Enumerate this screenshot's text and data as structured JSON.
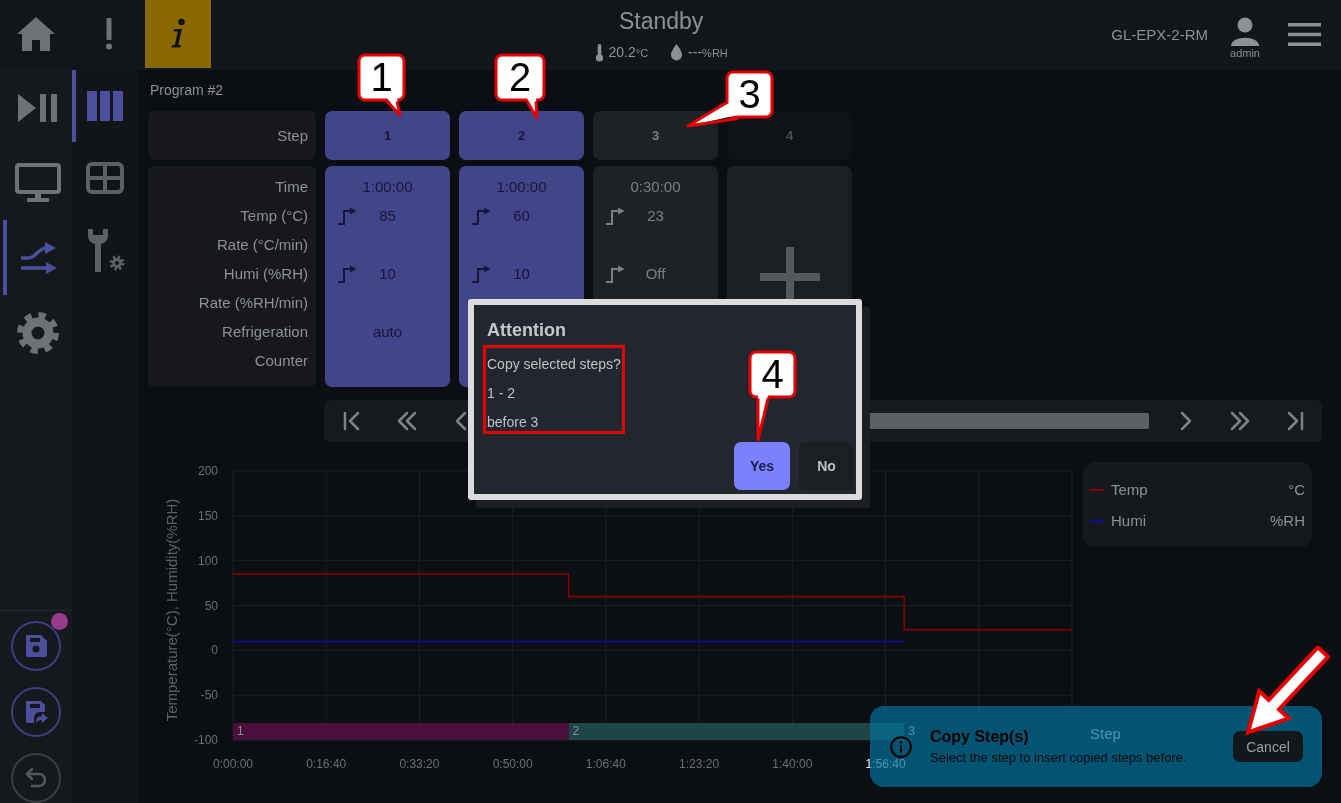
{
  "top_bar": {
    "buttons": [
      {
        "kind": "home",
        "highlighted": false
      },
      {
        "kind": "alert",
        "highlighted": false
      },
      {
        "kind": "info",
        "highlighted": true
      }
    ],
    "status": "Standby",
    "temperature": {
      "value": "20.2",
      "unit": "°C"
    },
    "humidity": {
      "value": "---",
      "unit": "%RH"
    },
    "device": "GL-EPX-2-RM",
    "user": "admin"
  },
  "nav_rail": [
    {
      "kind": "run",
      "selected": false
    },
    {
      "kind": "monitor",
      "selected": false
    },
    {
      "kind": "program",
      "selected": true
    },
    {
      "kind": "settings",
      "selected": false
    }
  ],
  "sub_rail": [
    {
      "kind": "columns",
      "selected": true
    },
    {
      "kind": "table",
      "selected": false
    },
    {
      "kind": "tools",
      "selected": false
    }
  ],
  "file_actions": [
    {
      "kind": "save",
      "badge": true,
      "disabled": false
    },
    {
      "kind": "save_as",
      "badge": false,
      "disabled": false
    },
    {
      "kind": "undo",
      "badge": false,
      "disabled": true
    }
  ],
  "program": {
    "title": "Program #2",
    "step_label": "Step",
    "field_labels": [
      "Time",
      "Temp (°C)",
      "Rate (°C/min)",
      "Humi (%RH)",
      "Rate (%RH/min)",
      "Refrigeration",
      "Counter"
    ],
    "steps": [
      {
        "kind": "step",
        "number": "1",
        "selected": true,
        "time": "1:00:00",
        "temp": "85",
        "humi": "10",
        "refrigeration": "auto"
      },
      {
        "kind": "step",
        "number": "2",
        "selected": true,
        "time": "1:00:00",
        "temp": "60",
        "humi": "10"
      },
      {
        "kind": "step",
        "number": "3",
        "selected": false,
        "time": "0:30:00",
        "temp": "23",
        "humi": "Off"
      },
      {
        "kind": "add",
        "number": "4"
      }
    ]
  },
  "pager": {
    "left": [
      {
        "kind": "first"
      },
      {
        "kind": "rewind"
      },
      {
        "kind": "back"
      }
    ],
    "right": [
      {
        "kind": "forward"
      },
      {
        "kind": "fast_forward"
      },
      {
        "kind": "last"
      }
    ]
  },
  "chart": {
    "chart_data": {
      "type": "line",
      "ylabel": "Temperature(°C), Humidity(%RH)",
      "x": [
        0,
        3600,
        3600,
        7200,
        7200,
        9000
      ],
      "series": [
        {
          "name": "Temp",
          "color": "#8b0000",
          "values": [
            85,
            85,
            60,
            60,
            23,
            23
          ]
        },
        {
          "name": "Humi",
          "color": "#0c0c9c",
          "values": [
            10,
            10,
            10,
            10,
            null,
            null
          ]
        }
      ],
      "xlim": [
        0,
        9000
      ],
      "ylim": [
        -100,
        200
      ],
      "xticks": [
        {
          "value": 0,
          "label": "0:00:00"
        },
        {
          "value": 1000,
          "label": "0:16:40"
        },
        {
          "value": 2000,
          "label": "0:33:20"
        },
        {
          "value": 3000,
          "label": "0:50:00"
        },
        {
          "value": 4000,
          "label": "1:06:40"
        },
        {
          "value": 5000,
          "label": "1:23:20"
        },
        {
          "value": 6000,
          "label": "1:40:00"
        },
        {
          "value": 7000,
          "label": "1:56:40"
        }
      ],
      "yticks": [
        -100,
        -50,
        0,
        50,
        100,
        150,
        200
      ],
      "grid": true
    },
    "step_band": [
      {
        "label": "1",
        "color": "#48103b"
      },
      {
        "label": "2",
        "color": "#1f4646"
      },
      {
        "label": "3"
      }
    ],
    "band_title": "Step",
    "legend": [
      {
        "unit": "°C"
      },
      {
        "unit": "%RH"
      }
    ]
  },
  "dialog": {
    "title": "Attention",
    "lines": [
      "Copy selected steps?",
      "1 - 2",
      "before 3"
    ],
    "buttons": [
      {
        "kind": "primary",
        "label": "Yes"
      },
      {
        "kind": "secondary",
        "label": "No"
      }
    ]
  },
  "toast": {
    "title": "Copy Step(s)",
    "message": "Select the step to insert copied steps before.",
    "action": "Cancel"
  },
  "callouts": [
    {
      "label": "1"
    },
    {
      "label": "2"
    },
    {
      "label": "3"
    },
    {
      "label": "4"
    }
  ]
}
